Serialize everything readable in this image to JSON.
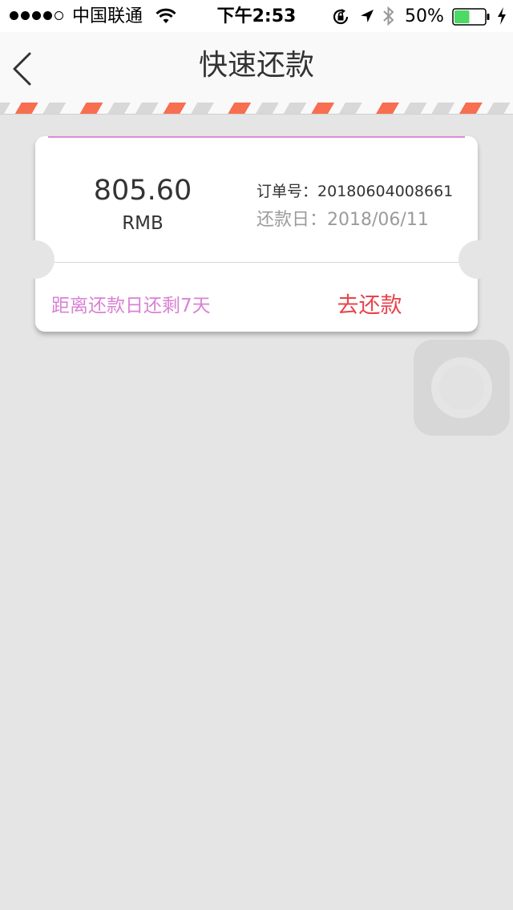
{
  "status_bar": {
    "carrier": "中国联通",
    "time": "下午2:53",
    "battery_percent": "50%",
    "battery_level": 0.5,
    "signal_strength": 4,
    "icons": [
      "wifi-icon",
      "rotation-lock-icon",
      "location-icon",
      "bluetooth-icon",
      "battery-icon",
      "charging-icon"
    ]
  },
  "nav": {
    "title": "快速还款",
    "back_icon": "chevron-left-icon"
  },
  "ticket": {
    "amount": "805.60",
    "currency": "RMB",
    "order_label": "订单号：",
    "order_number": "20180604008661",
    "due_label": "还款日：",
    "due_date": "2018/06/11",
    "countdown_text": "距离还款日还剩7天",
    "repay_button_label": "去还款"
  },
  "colors": {
    "accent_pink": "#d982d4",
    "repay_red": "#e8444c",
    "stripe_orange": "#f76e50",
    "background": "#e5e5e5"
  }
}
